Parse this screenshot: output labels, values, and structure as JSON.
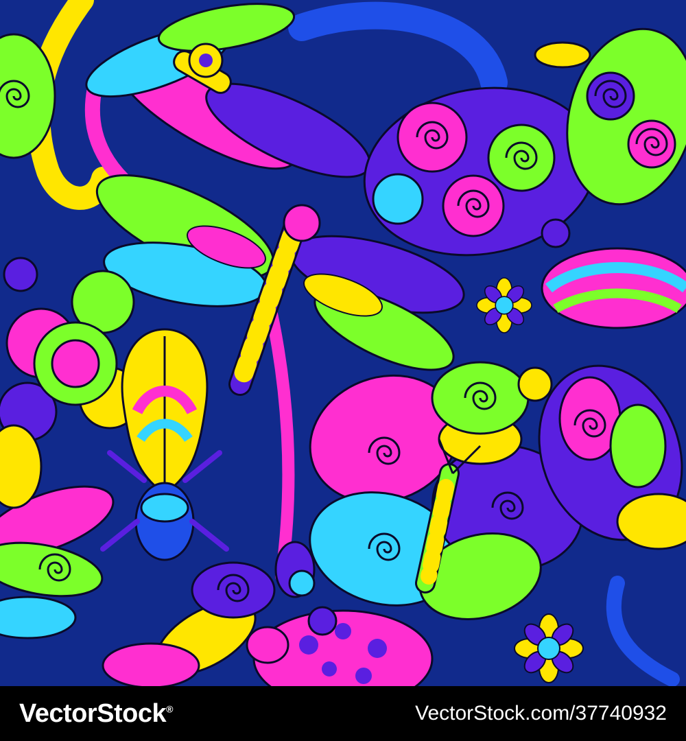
{
  "image": {
    "subject": "seamless-pattern",
    "colors": {
      "background": "#112a8c",
      "pink": "#ff2fd0",
      "yellow": "#ffe600",
      "green": "#7cff2a",
      "cyan": "#35d4ff",
      "purple": "#5a1fe0",
      "blue": "#1f4fe8",
      "outline": "#0a0a2a"
    }
  },
  "footer": {
    "brand": "VectorStock",
    "registered": "®",
    "stock_id": "VectorStock.com/37740932"
  }
}
